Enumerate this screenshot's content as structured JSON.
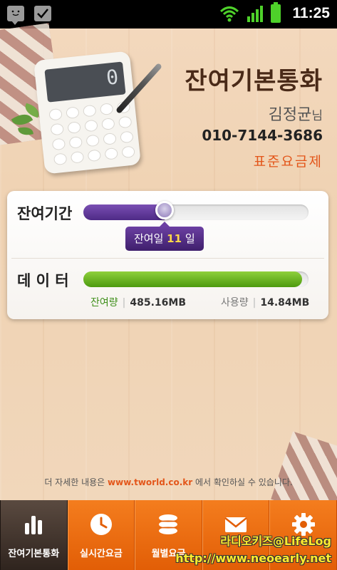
{
  "status_bar": {
    "time": "11:25",
    "icons": [
      "chat-icon",
      "checkbox-icon",
      "wifi-icon",
      "signal-icon",
      "battery-icon"
    ]
  },
  "header": {
    "title": "잔여기본통화",
    "user_name": "김정균",
    "user_suffix": "님",
    "phone": "010-7144-3686",
    "plan": "표준요금제",
    "calculator_display": "0"
  },
  "card": {
    "period": {
      "label": "잔여기간",
      "bubble_prefix": "잔여일 ",
      "days": "11",
      "bubble_suffix": " 일",
      "fraction": 0.36
    },
    "data": {
      "label": "데 이 터",
      "fraction": 0.97,
      "remaining_label": "잔여량",
      "remaining_value": "485.16MB",
      "used_label": "사용량",
      "used_value": "14.84MB"
    }
  },
  "note": {
    "prefix": "더 자세한 내용은 ",
    "url": "www.tworld.co.kr",
    "suffix": " 에서 확인하실 수 있습니다."
  },
  "tabs": [
    {
      "label": "잔여기본통화",
      "icon": "bar-chart-icon",
      "active": true
    },
    {
      "label": "실시간요금",
      "icon": "clock-icon",
      "active": false
    },
    {
      "label": "월별요금",
      "icon": "coins-icon",
      "active": false
    },
    {
      "label": "",
      "icon": "mail-icon",
      "active": false
    },
    {
      "label": "",
      "icon": "gear-icon",
      "active": false
    }
  ],
  "watermark": {
    "line1": "라디오키즈@LifeLog",
    "line2": "http://www.neoearly.net"
  },
  "colors": {
    "accent_orange": "#e3561a",
    "period_purple": "#4e2a86",
    "data_green": "#4c9a0f",
    "tab_orange": "#f47d1e"
  }
}
